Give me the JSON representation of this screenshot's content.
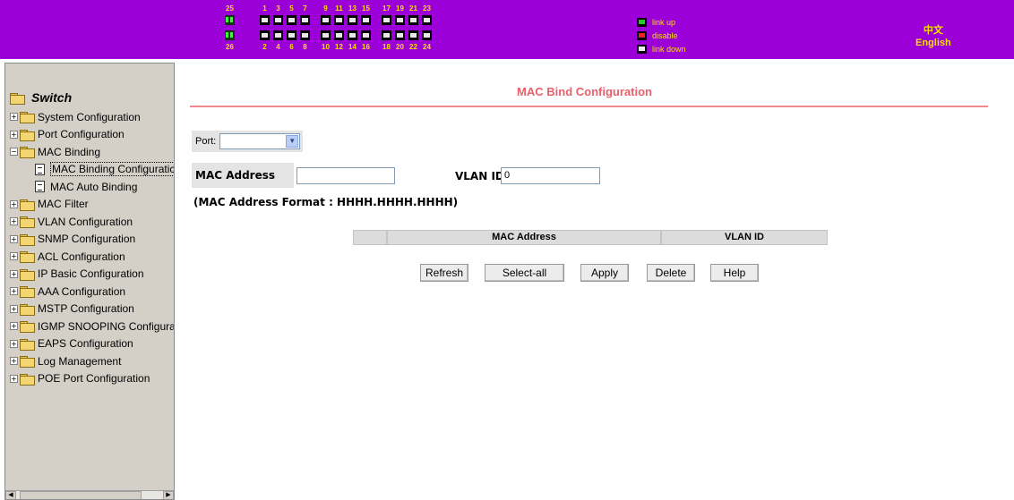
{
  "header": {
    "port_top_numbers": [
      "25",
      "1",
      "3",
      "5",
      "7",
      "9",
      "11",
      "13",
      "15",
      "17",
      "19",
      "21",
      "23"
    ],
    "port_bottom_numbers": [
      "26",
      "2",
      "4",
      "6",
      "8",
      "10",
      "12",
      "14",
      "16",
      "18",
      "20",
      "22",
      "24"
    ],
    "legend": [
      {
        "label": "link up",
        "icon": "port-link-up-icon"
      },
      {
        "label": "disable",
        "icon": "port-disabled-icon"
      },
      {
        "label": "link down",
        "icon": "port-link-down-icon"
      }
    ],
    "lang_chinese": "中文",
    "lang_english": "English"
  },
  "sidebar": {
    "root_label": "Switch",
    "items": [
      {
        "label": "System Configuration"
      },
      {
        "label": "Port Configuration"
      },
      {
        "label": "MAC Binding"
      },
      {
        "label": "MAC Binding Configuratic"
      },
      {
        "label": "MAC Auto Binding"
      },
      {
        "label": "MAC Filter"
      },
      {
        "label": "VLAN Configuration"
      },
      {
        "label": "SNMP Configuration"
      },
      {
        "label": "ACL Configuration"
      },
      {
        "label": "IP Basic Configuration"
      },
      {
        "label": "AAA Configuration"
      },
      {
        "label": "MSTP Configuration"
      },
      {
        "label": "IGMP SNOOPING Configura"
      },
      {
        "label": "EAPS Configuration"
      },
      {
        "label": "Log Management"
      },
      {
        "label": "POE Port Configuration"
      }
    ]
  },
  "main": {
    "title": "MAC Bind Configuration",
    "port_label": "Port:",
    "port_value": "",
    "mac_label": "MAC Address",
    "mac_value": "",
    "vlan_label": "VLAN ID",
    "vlan_value": "0",
    "format_note": "(MAC Address Format : HHHH.HHHH.HHHH)",
    "table_headers": [
      "",
      "MAC Address",
      "VLAN ID"
    ],
    "buttons": {
      "refresh": "Refresh",
      "select_all": "Select-all",
      "apply": "Apply",
      "delete": "Delete",
      "help": "Help"
    }
  }
}
